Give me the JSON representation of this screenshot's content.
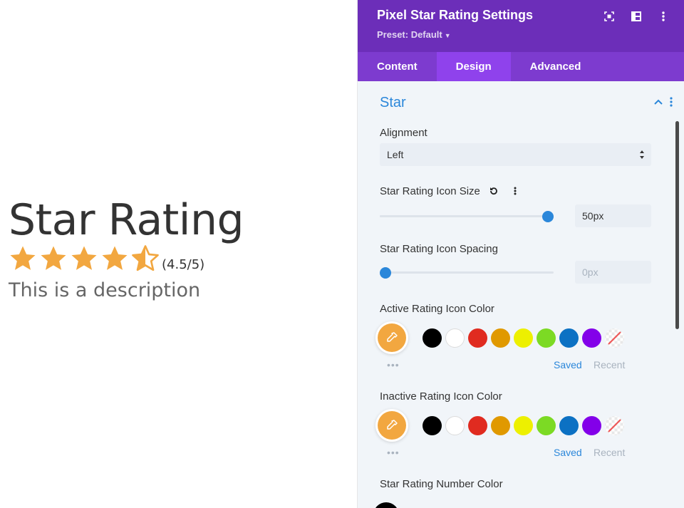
{
  "preview": {
    "title": "Star Rating",
    "rating_text": "(4.5/5)",
    "rating_value": 4.5,
    "rating_max": 5,
    "description": "This is a description",
    "star_color": "#f2a740"
  },
  "panel": {
    "title": "Pixel Star Rating Settings",
    "preset": "Preset: Default",
    "header_icons": [
      "focus-icon",
      "split-view-icon",
      "more-vertical-icon"
    ],
    "tabs": [
      {
        "label": "Content",
        "active": false
      },
      {
        "label": "Design",
        "active": true
      },
      {
        "label": "Advanced",
        "active": false
      }
    ],
    "section_title": "Star",
    "alignment": {
      "label": "Alignment",
      "value": "Left"
    },
    "icon_size": {
      "label": "Star Rating Icon Size",
      "value": "50px",
      "slider_fraction": 0.97
    },
    "icon_spacing": {
      "label": "Star Rating Icon Spacing",
      "placeholder": "0px",
      "slider_fraction": 0.0
    },
    "active_color": {
      "label": "Active Rating Icon Color"
    },
    "inactive_color": {
      "label": "Inactive Rating Icon Color"
    },
    "number_color": {
      "label": "Star Rating Number Color"
    },
    "swatches": [
      {
        "name": "black",
        "color": "#000000"
      },
      {
        "name": "white",
        "color": "#ffffff"
      },
      {
        "name": "red",
        "color": "#e02b20"
      },
      {
        "name": "orange",
        "color": "#e09900"
      },
      {
        "name": "yellow",
        "color": "#edf000"
      },
      {
        "name": "green",
        "color": "#7cda24"
      },
      {
        "name": "blue",
        "color": "#0c71c3"
      },
      {
        "name": "purple",
        "color": "#8300e9"
      },
      {
        "name": "none",
        "color": "none"
      }
    ],
    "saved_label": "Saved",
    "recent_label": "Recent",
    "picker_color": "#f2a740",
    "accent": "#2b87da",
    "header_bg": "#6c2eb9",
    "tabs_bg": "#7d3bcf"
  }
}
